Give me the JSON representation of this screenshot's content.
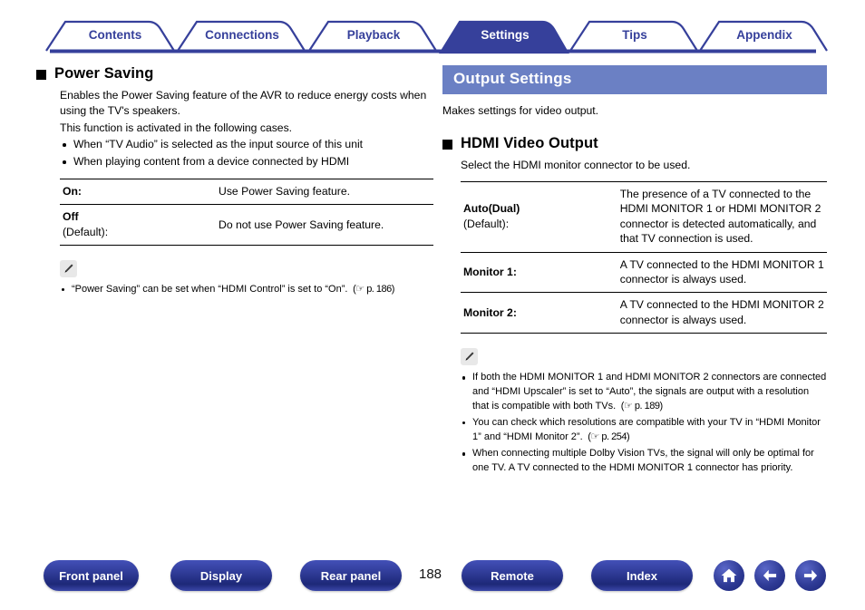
{
  "nav": {
    "tabs": [
      {
        "label": "Contents",
        "active": false
      },
      {
        "label": "Connections",
        "active": false
      },
      {
        "label": "Playback",
        "active": false
      },
      {
        "label": "Settings",
        "active": true
      },
      {
        "label": "Tips",
        "active": false
      },
      {
        "label": "Appendix",
        "active": false
      }
    ],
    "active_color": "#36409b",
    "inactive_text_color": "#36409b"
  },
  "left": {
    "heading": "Power Saving",
    "paragraphs": [
      "Enables the Power Saving feature of the AVR to reduce energy costs when using the TV's speakers.",
      "This function is activated in the following cases."
    ],
    "bullets": [
      "When “TV Audio” is selected as the input source of this unit",
      "When playing content from a device connected by HDMI"
    ],
    "table": [
      {
        "key": "On:",
        "key_sub": "",
        "value": "Use Power Saving feature."
      },
      {
        "key": "Off",
        "key_sub": "(Default):",
        "value": "Do not use Power Saving feature."
      }
    ],
    "notes": [
      {
        "text": "“Power Saving” can be set when “HDMI Control” is set to “On”.",
        "ref": "p. 186"
      }
    ]
  },
  "right": {
    "band_title": "Output Settings",
    "band_color": "#6b80c4",
    "intro": "Makes settings for video output.",
    "heading": "HDMI Video Output",
    "subtitle": "Select the HDMI monitor connector to be used.",
    "table": [
      {
        "key": "Auto(Dual)",
        "key_sub": "(Default):",
        "value": "The presence of a TV connected to the HDMI MONITOR 1 or HDMI MONITOR 2 connector is detected automatically, and that TV connection is used."
      },
      {
        "key": "Monitor 1:",
        "key_sub": "",
        "value": "A TV connected to the HDMI MONITOR 1 connector is always used."
      },
      {
        "key": "Monitor 2:",
        "key_sub": "",
        "value": "A TV connected to the HDMI MONITOR 2 connector is always used."
      }
    ],
    "notes": [
      {
        "text": "If both the HDMI MONITOR 1 and HDMI MONITOR 2 connectors are connected and “HDMI Upscaler” is set to “Auto”, the signals are output with a resolution that is compatible with both TVs.",
        "ref": "p. 189"
      },
      {
        "text": "You can check which resolutions are compatible with your TV in “HDMI Monitor 1” and “HDMI Monitor 2”.",
        "ref": "p. 254"
      },
      {
        "text": "When connecting multiple Dolby Vision TVs, the signal will only be optimal for one TV. A TV connected to the HDMI MONITOR 1 connector has priority.",
        "ref": ""
      }
    ]
  },
  "footer": {
    "buttons": [
      {
        "label": "Front panel"
      },
      {
        "label": "Display"
      },
      {
        "label": "Rear panel"
      },
      {
        "label": "Remote"
      },
      {
        "label": "Index"
      }
    ],
    "page_number": "188",
    "icons": [
      "home-icon",
      "back-arrow-icon",
      "forward-arrow-icon"
    ]
  }
}
